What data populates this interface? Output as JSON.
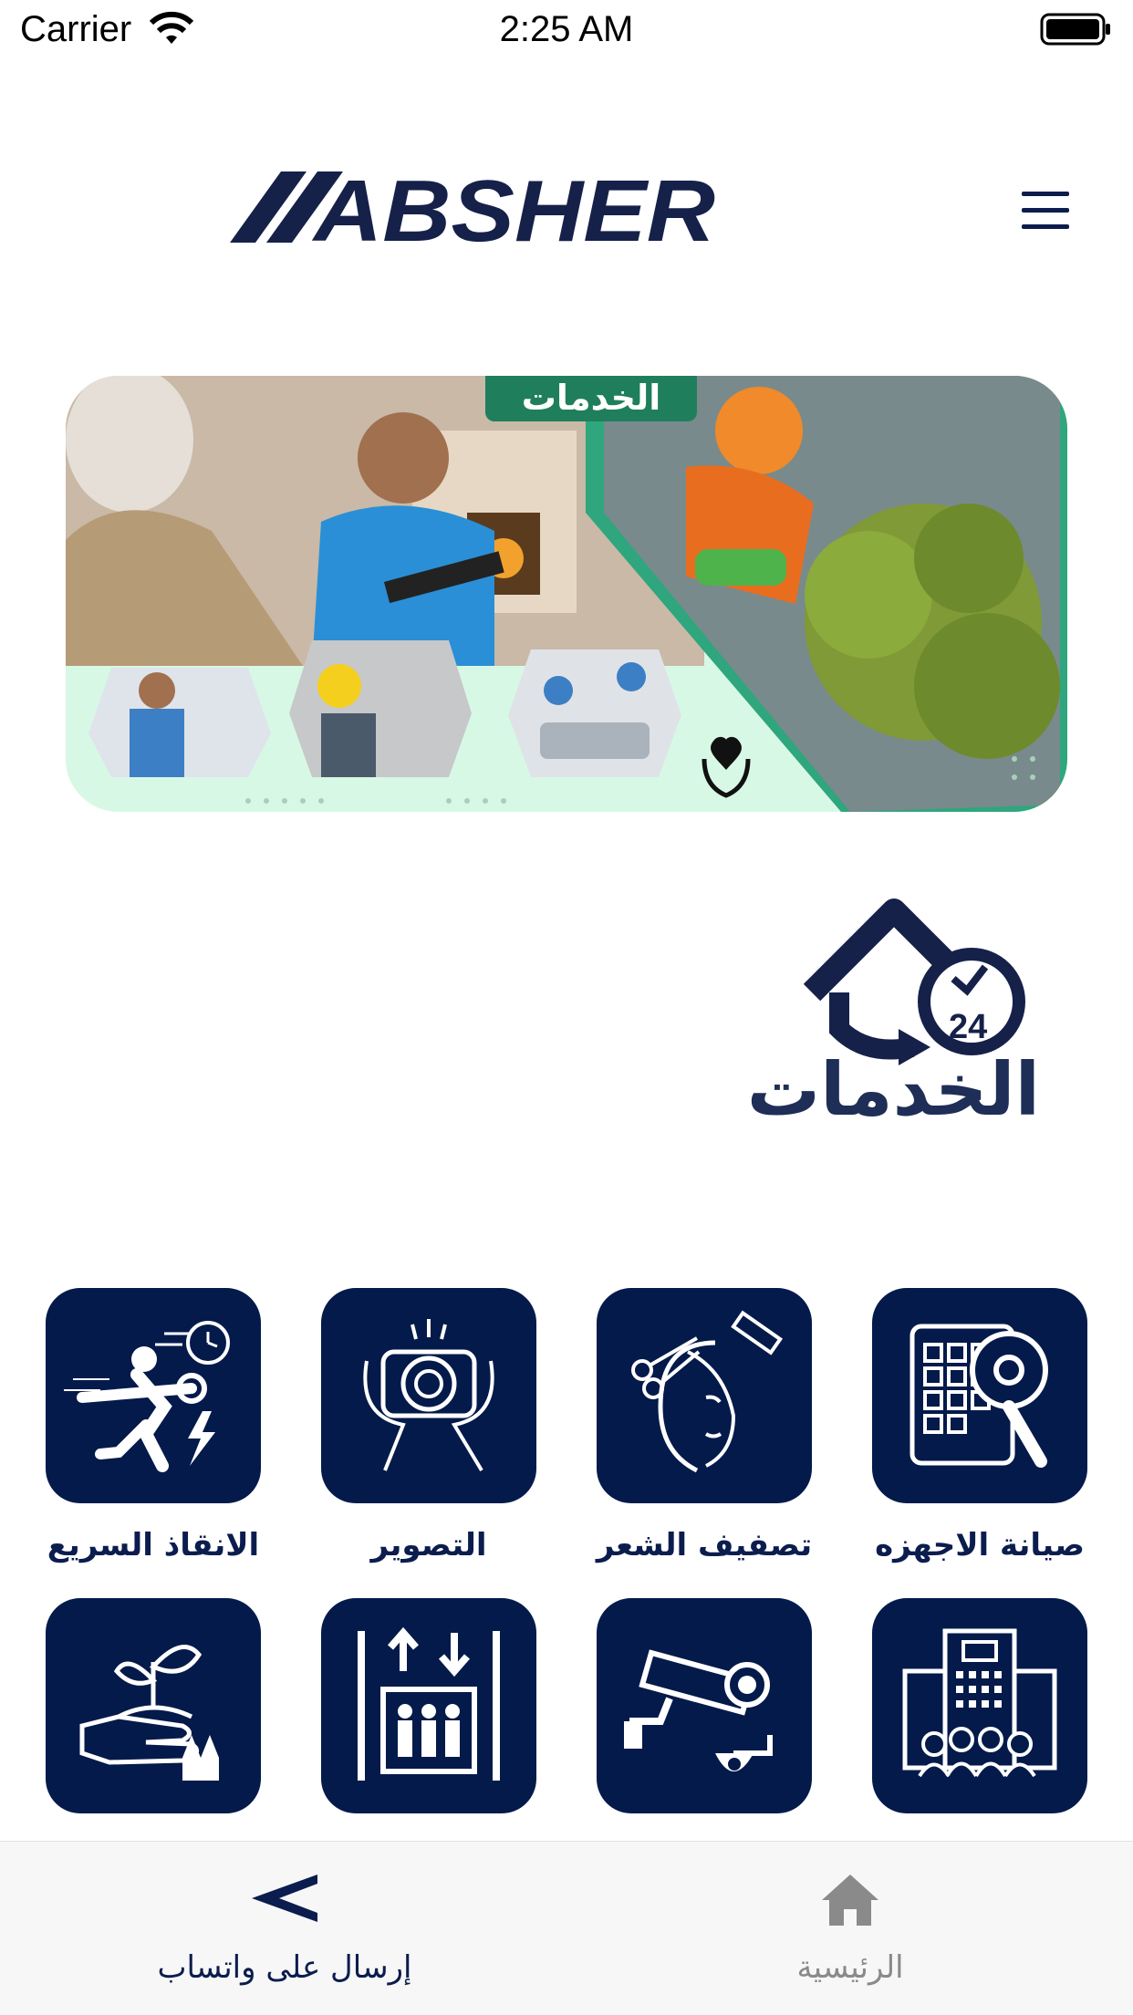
{
  "status_bar": {
    "carrier": "Carrier",
    "time": "2:25 AM",
    "wifi_icon": "wifi-icon",
    "battery_icon": "battery-icon"
  },
  "header": {
    "logo_text": "ABSHER",
    "menu_icon": "hamburger-menu-icon"
  },
  "banner": {
    "badge": "الخدمات"
  },
  "services_brand": {
    "title": "الخدمات",
    "badge_number": "24",
    "icon": "home-24h-service-icon"
  },
  "services": [
    {
      "label": "صيانة الاجهزه",
      "icon": "appliance-repair-icon"
    },
    {
      "label": "تصفيف الشعر",
      "icon": "hair-styling-icon"
    },
    {
      "label": "التصوير",
      "icon": "camera-photography-icon"
    },
    {
      "label": "الانقاذ السريع",
      "icon": "quick-rescue-icon"
    },
    {
      "label": "",
      "icon": "building-maintenance-icon"
    },
    {
      "label": "",
      "icon": "security-camera-icon"
    },
    {
      "label": "",
      "icon": "elevator-icon"
    },
    {
      "label": "",
      "icon": "gardening-icon"
    }
  ],
  "tab_bar": {
    "whatsapp_label": "إرسال على واتساب",
    "home_label": "الرئيسية"
  },
  "colors": {
    "navy": "#041a4b",
    "banner_green": "#1f7f5c",
    "banner_mint": "#d8f8e6",
    "tab_bar_bg": "#f7f7f7"
  }
}
